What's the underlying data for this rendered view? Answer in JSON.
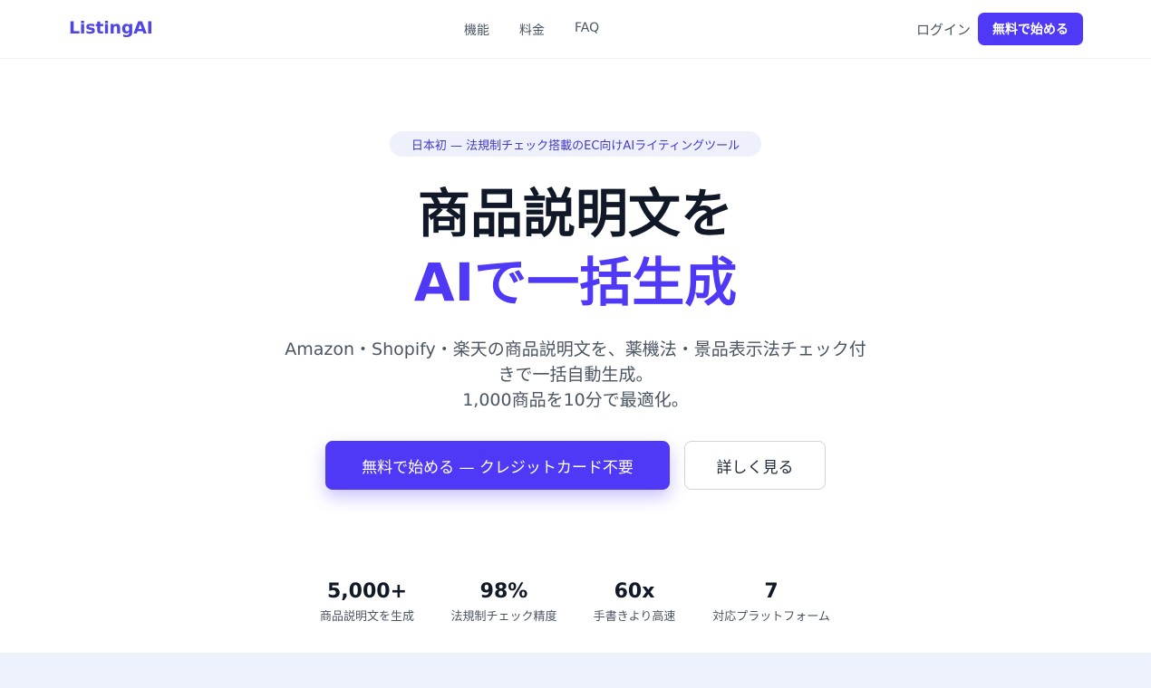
{
  "header": {
    "logo": "ListingAI",
    "nav": [
      "機能",
      "料金",
      "FAQ"
    ],
    "login": "ログイン",
    "cta": "無料で始める"
  },
  "hero": {
    "badge": "日本初 — 法規制チェック搭載のEC向けAIライティングツール",
    "title_line1": "商品説明文を",
    "title_line2": "AIで一括生成",
    "subtitle_line1": "Amazon・Shopify・楽天の商品説明文を、薬機法・景品表示法チェック付",
    "subtitle_line2": "きで一括自動生成。",
    "subtitle_line3": "1,000商品を10分で最適化。",
    "cta_primary": "無料で始める — クレジットカード不要",
    "cta_secondary": "詳しく見る"
  },
  "stats": [
    {
      "value": "5,000+",
      "label": "商品説明文を生成"
    },
    {
      "value": "98%",
      "label": "法規制チェック精度"
    },
    {
      "value": "60x",
      "label": "手書きより高速"
    },
    {
      "value": "7",
      "label": "対応プラットフォーム"
    }
  ],
  "colors": {
    "accent": "#4f39f6",
    "text": "#111827",
    "muted": "#4b5563",
    "badge_bg": "#eef0fc",
    "band_bg": "#eef2fc"
  }
}
